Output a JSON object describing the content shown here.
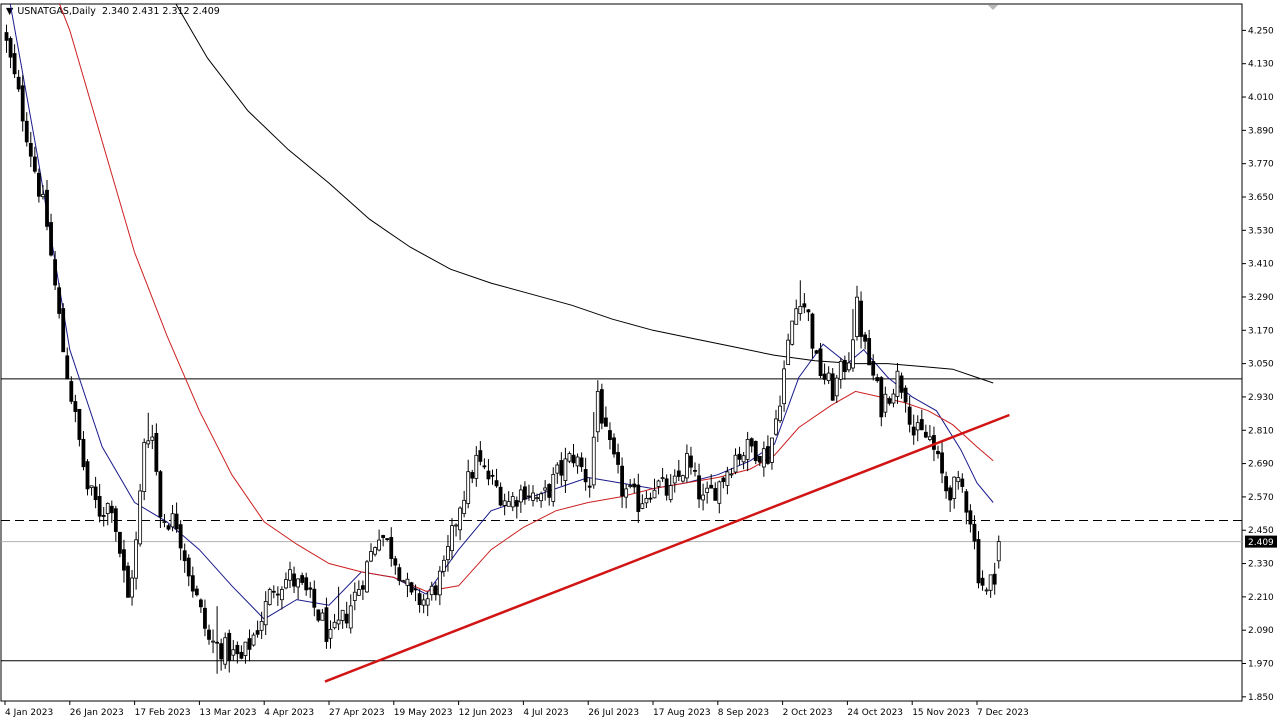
{
  "header": {
    "collapse_icon": "triangle-down-icon",
    "symbol": "USNATGAS,Daily",
    "ohlc": "2.340 2.431 2.312 2.409"
  },
  "current_price_label": "2.409",
  "colors": {
    "up": "#000000",
    "down": "#000000",
    "ma_fast": "#1a1a8c",
    "ma_mid": "#cc1f1f",
    "ma_slow": "#000000",
    "trendline": "#d11414",
    "hline": "#000000",
    "price_tag_bg": "#000000",
    "price_tag_fg": "#ffffff"
  },
  "chart_data": {
    "type": "candlestick",
    "y_ticks": [
      "4.250",
      "4.130",
      "4.010",
      "3.890",
      "3.770",
      "3.650",
      "3.530",
      "3.410",
      "3.290",
      "3.170",
      "3.050",
      "2.930",
      "2.810",
      "2.690",
      "2.570",
      "2.450",
      "2.330",
      "2.210",
      "2.090",
      "1.970",
      "1.850"
    ],
    "ylim": [
      1.835,
      4.345
    ],
    "x_ticks": [
      "4 Jan 2023",
      "26 Jan 2023",
      "17 Feb 2023",
      "13 Mar 2023",
      "4 Apr 2023",
      "27 Apr 2023",
      "19 May 2023",
      "12 Jun 2023",
      "4 Jul 2023",
      "26 Jul 2023",
      "17 Aug 2023",
      "8 Sep 2023",
      "2 Oct 2023",
      "24 Oct 2023",
      "15 Nov 2023",
      "7 Dec 2023"
    ],
    "x_tick_index": [
      0,
      16,
      32,
      48,
      64,
      80,
      96,
      112,
      128,
      144,
      160,
      176,
      192,
      208,
      224,
      240
    ],
    "n_bars": 246,
    "close_anchors": [
      [
        0,
        4.2
      ],
      [
        4,
        3.95
      ],
      [
        10,
        3.55
      ],
      [
        14,
        3.1
      ],
      [
        17,
        2.85
      ],
      [
        20,
        2.6
      ],
      [
        23,
        2.52
      ],
      [
        26,
        2.55
      ],
      [
        30,
        2.2
      ],
      [
        32,
        2.4
      ],
      [
        34,
        2.75
      ],
      [
        36,
        2.82
      ],
      [
        38,
        2.5
      ],
      [
        42,
        2.48
      ],
      [
        46,
        2.25
      ],
      [
        50,
        2.05
      ],
      [
        54,
        2.02
      ],
      [
        58,
        1.98
      ],
      [
        62,
        2.1
      ],
      [
        66,
        2.25
      ],
      [
        70,
        2.28
      ],
      [
        74,
        2.22
      ],
      [
        78,
        2.12
      ],
      [
        80,
        2.05
      ],
      [
        84,
        2.15
      ],
      [
        88,
        2.28
      ],
      [
        92,
        2.45
      ],
      [
        96,
        2.35
      ],
      [
        100,
        2.2
      ],
      [
        104,
        2.2
      ],
      [
        108,
        2.3
      ],
      [
        112,
        2.55
      ],
      [
        116,
        2.7
      ],
      [
        120,
        2.62
      ],
      [
        124,
        2.55
      ],
      [
        128,
        2.6
      ],
      [
        132,
        2.55
      ],
      [
        136,
        2.65
      ],
      [
        140,
        2.72
      ],
      [
        144,
        2.62
      ],
      [
        146,
        2.95
      ],
      [
        148,
        2.78
      ],
      [
        152,
        2.6
      ],
      [
        156,
        2.55
      ],
      [
        160,
        2.62
      ],
      [
        164,
        2.58
      ],
      [
        168,
        2.7
      ],
      [
        172,
        2.55
      ],
      [
        176,
        2.62
      ],
      [
        180,
        2.72
      ],
      [
        184,
        2.75
      ],
      [
        188,
        2.72
      ],
      [
        190,
        2.85
      ],
      [
        194,
        3.2
      ],
      [
        196,
        3.3
      ],
      [
        198,
        3.22
      ],
      [
        200,
        3.05
      ],
      [
        204,
        2.95
      ],
      [
        208,
        3.08
      ],
      [
        210,
        3.25
      ],
      [
        212,
        3.1
      ],
      [
        216,
        2.9
      ],
      [
        220,
        3.0
      ],
      [
        222,
        2.95
      ],
      [
        224,
        2.8
      ],
      [
        228,
        2.78
      ],
      [
        232,
        2.6
      ],
      [
        236,
        2.6
      ],
      [
        238,
        2.5
      ],
      [
        240,
        2.3
      ],
      [
        242,
        2.22
      ],
      [
        244,
        2.3
      ],
      [
        245,
        2.41
      ]
    ],
    "wick_big_index": [
      35,
      52,
      82,
      145,
      196,
      209
    ],
    "ma_fast": [
      [
        0,
        4.45
      ],
      [
        8,
        3.8
      ],
      [
        16,
        3.1
      ],
      [
        24,
        2.75
      ],
      [
        32,
        2.55
      ],
      [
        40,
        2.48
      ],
      [
        48,
        2.38
      ],
      [
        56,
        2.25
      ],
      [
        64,
        2.13
      ],
      [
        72,
        2.2
      ],
      [
        80,
        2.18
      ],
      [
        88,
        2.3
      ],
      [
        96,
        2.28
      ],
      [
        104,
        2.22
      ],
      [
        112,
        2.38
      ],
      [
        120,
        2.52
      ],
      [
        128,
        2.56
      ],
      [
        136,
        2.6
      ],
      [
        144,
        2.64
      ],
      [
        152,
        2.62
      ],
      [
        160,
        2.6
      ],
      [
        168,
        2.62
      ],
      [
        176,
        2.65
      ],
      [
        184,
        2.7
      ],
      [
        190,
        2.76
      ],
      [
        196,
        3.0
      ],
      [
        202,
        3.12
      ],
      [
        208,
        3.05
      ],
      [
        212,
        3.1
      ],
      [
        218,
        3.0
      ],
      [
        224,
        2.93
      ],
      [
        230,
        2.88
      ],
      [
        236,
        2.74
      ],
      [
        240,
        2.62
      ],
      [
        244,
        2.55
      ]
    ],
    "ma_mid": [
      [
        8,
        4.55
      ],
      [
        16,
        4.25
      ],
      [
        24,
        3.85
      ],
      [
        32,
        3.45
      ],
      [
        40,
        3.15
      ],
      [
        48,
        2.88
      ],
      [
        56,
        2.65
      ],
      [
        64,
        2.48
      ],
      [
        72,
        2.4
      ],
      [
        80,
        2.33
      ],
      [
        88,
        2.3
      ],
      [
        96,
        2.28
      ],
      [
        104,
        2.23
      ],
      [
        112,
        2.25
      ],
      [
        120,
        2.38
      ],
      [
        128,
        2.46
      ],
      [
        136,
        2.52
      ],
      [
        144,
        2.55
      ],
      [
        152,
        2.57
      ],
      [
        160,
        2.6
      ],
      [
        168,
        2.62
      ],
      [
        176,
        2.64
      ],
      [
        184,
        2.67
      ],
      [
        190,
        2.72
      ],
      [
        196,
        2.82
      ],
      [
        204,
        2.9
      ],
      [
        210,
        2.95
      ],
      [
        216,
        2.93
      ],
      [
        222,
        2.91
      ],
      [
        228,
        2.88
      ],
      [
        234,
        2.83
      ],
      [
        240,
        2.75
      ],
      [
        244,
        2.7
      ]
    ],
    "ma_slow": [
      [
        38,
        4.45
      ],
      [
        50,
        4.15
      ],
      [
        60,
        3.96
      ],
      [
        70,
        3.82
      ],
      [
        80,
        3.7
      ],
      [
        90,
        3.57
      ],
      [
        100,
        3.47
      ],
      [
        110,
        3.39
      ],
      [
        120,
        3.34
      ],
      [
        130,
        3.3
      ],
      [
        140,
        3.26
      ],
      [
        150,
        3.21
      ],
      [
        160,
        3.17
      ],
      [
        170,
        3.14
      ],
      [
        180,
        3.11
      ],
      [
        190,
        3.08
      ],
      [
        200,
        3.06
      ],
      [
        210,
        3.05
      ],
      [
        218,
        3.05
      ],
      [
        226,
        3.04
      ],
      [
        234,
        3.03
      ],
      [
        240,
        3.0
      ],
      [
        244,
        2.98
      ]
    ],
    "trendline": [
      [
        79,
        1.905
      ],
      [
        248,
        2.865
      ]
    ],
    "hlines": [
      {
        "y": 2.995,
        "style": "solid"
      },
      {
        "y": 2.485,
        "style": "dashed"
      },
      {
        "y": 1.98,
        "style": "solid"
      },
      {
        "y": 2.409,
        "style": "current"
      }
    ]
  }
}
